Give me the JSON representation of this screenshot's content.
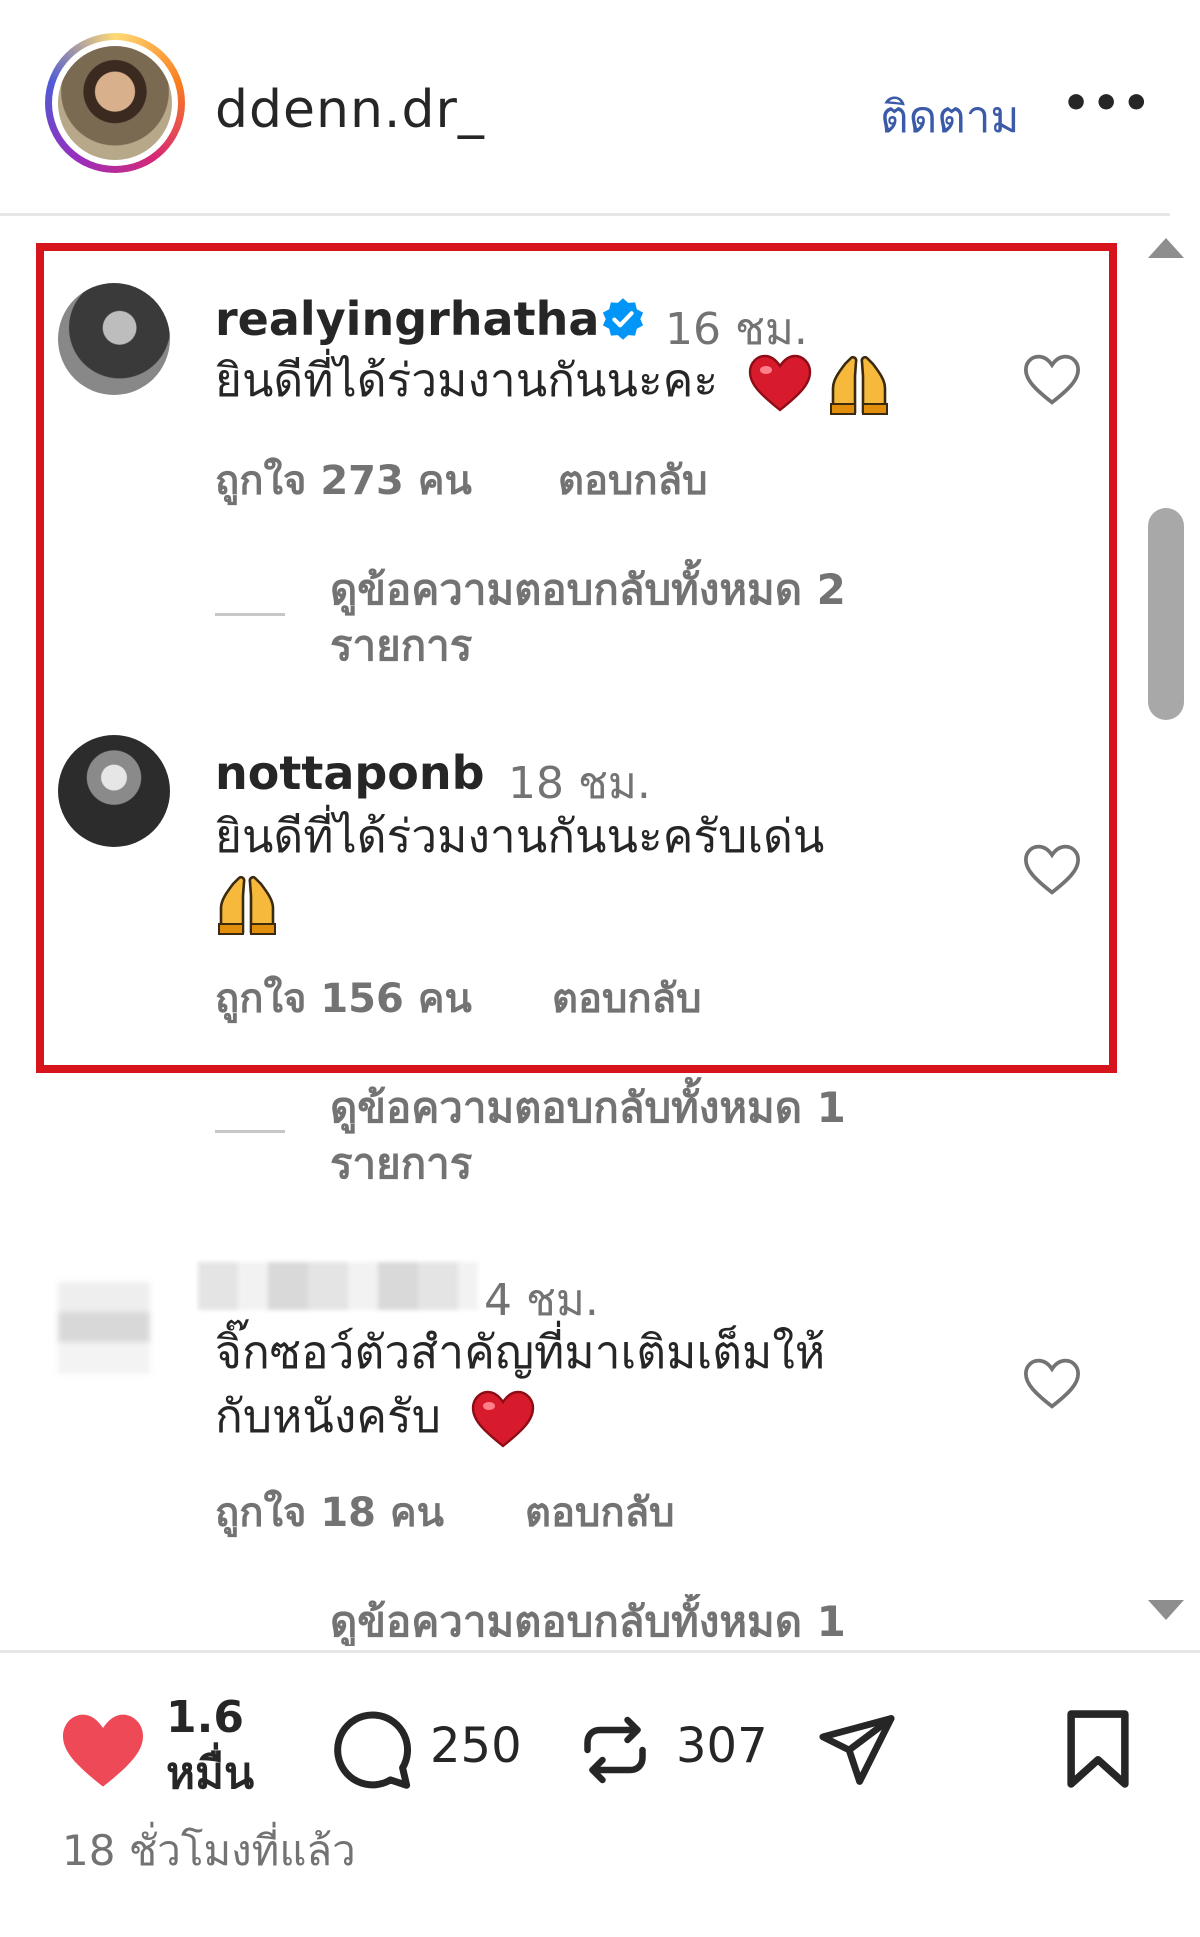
{
  "header": {
    "username": "ddenn.dr_",
    "follow_label": "ติดตาม",
    "more_icon": "more-horizontal-icon",
    "more_label": "•••"
  },
  "comments": [
    {
      "username": "realyingrhatha",
      "verified": true,
      "time": "16 ชม.",
      "text": "ยินดีที่ได้ร่วมงานกันนะคะ",
      "emojis": [
        "red-heart",
        "praying-hands"
      ],
      "likes": "ถูกใจ 273 คน",
      "reply_label": "ตอบกลับ",
      "view_replies_line1": "ดูข้อความตอบกลับทั้งหมด 2",
      "view_replies_line2": "รายการ"
    },
    {
      "username": "nottaponb",
      "verified": false,
      "time": "18 ชม.",
      "text": "ยินดีที่ได้ร่วมงานกันนะครับเด่น",
      "emojis": [
        "praying-hands"
      ],
      "likes": "ถูกใจ 156 คน",
      "reply_label": "ตอบกลับ",
      "view_replies_line1": "ดูข้อความตอบกลับทั้งหมด 1",
      "view_replies_line2": "รายการ"
    },
    {
      "username": "",
      "verified": false,
      "time": "4 ชม.",
      "text_line1": "จิ๊กซอว์ตัวสำคัญที่มาเติมเต็มให้",
      "text_line2": "กับหนังครับ",
      "emojis": [
        "red-heart"
      ],
      "likes": "ถูกใจ 18 คน",
      "reply_label": "ตอบกลับ",
      "view_replies_line1": "ดูข้อความตอบกลับทั้งหมด 1"
    }
  ],
  "actions": {
    "likes_line1": "1.6",
    "likes_line2": "หมื่น",
    "comments_count": "250",
    "reposts_count": "307",
    "like_icon": "heart-filled-icon",
    "comment_icon": "comment-icon",
    "repost_icon": "repost-icon",
    "share_icon": "send-icon",
    "save_icon": "bookmark-icon",
    "like_color": "#ed4956"
  },
  "timestamp": "18 ชั่วโมงที่แล้ว",
  "colors": {
    "highlight_border": "#d7141c",
    "follow_link": "#3b5aa8",
    "verified_badge": "#0095f6"
  }
}
